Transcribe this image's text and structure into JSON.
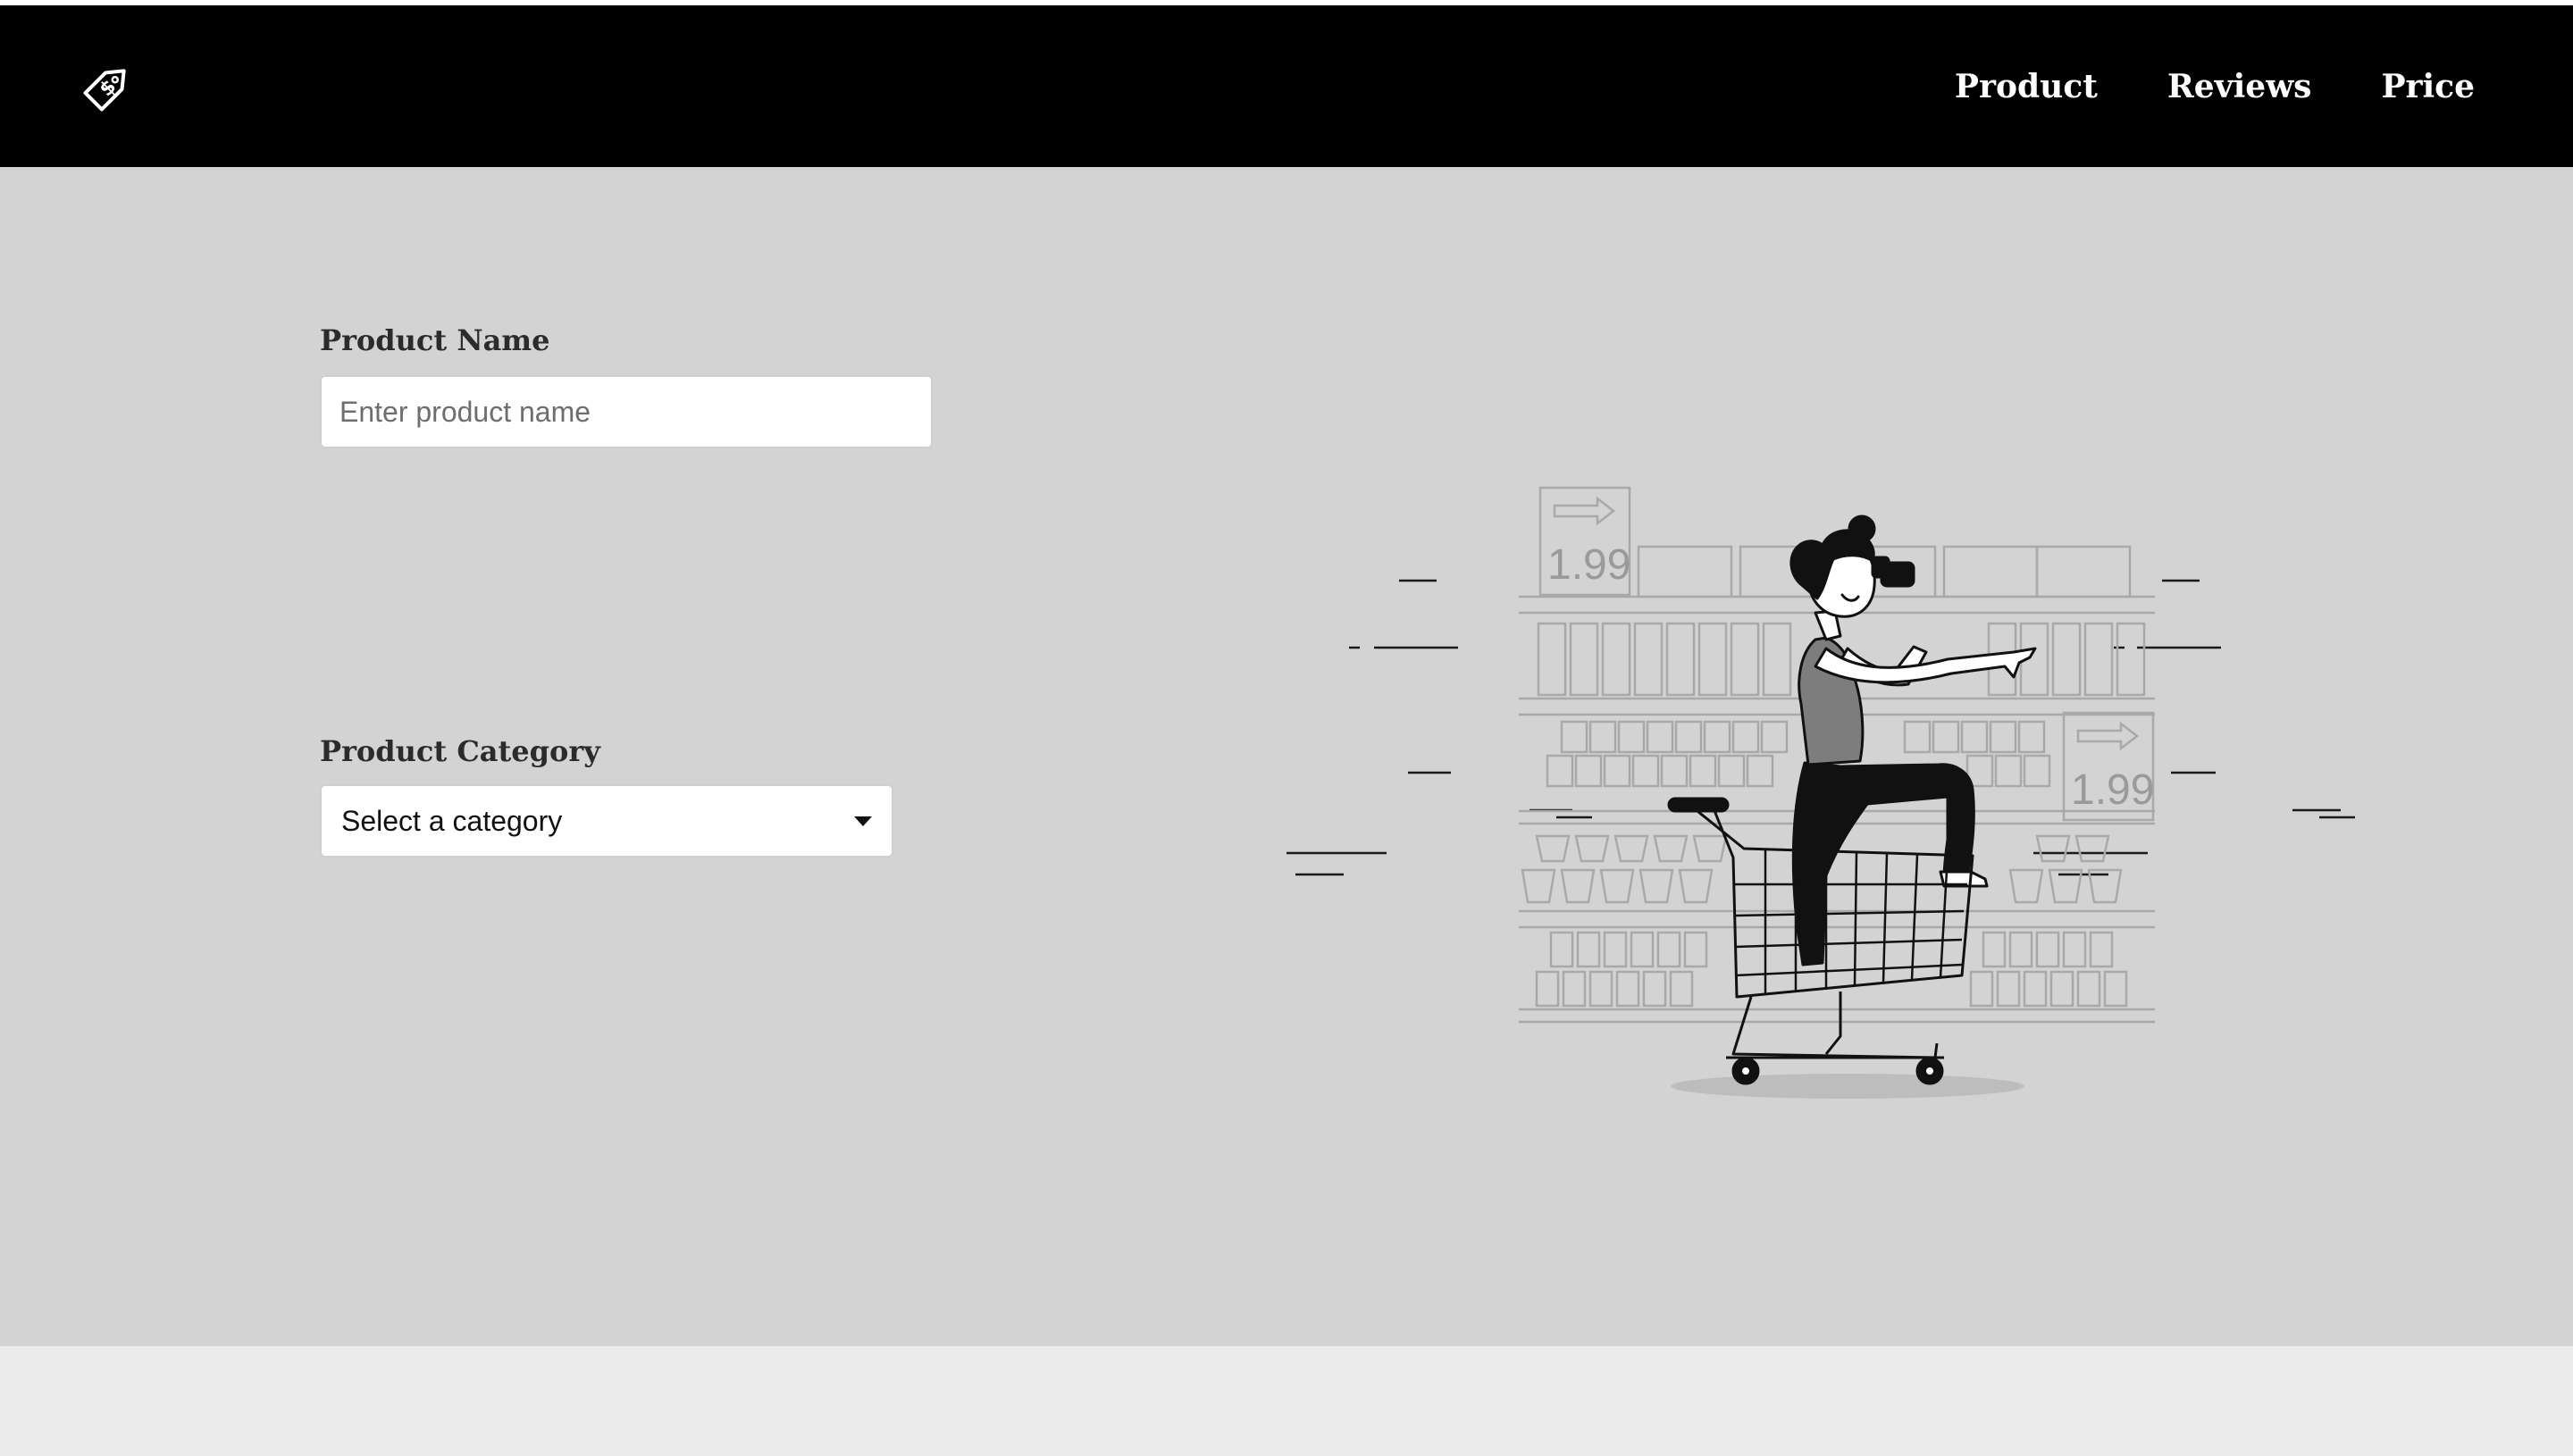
{
  "navbar": {
    "logo_icon": "price-tag-dollar-icon",
    "links": [
      {
        "label": "Product"
      },
      {
        "label": "Reviews"
      },
      {
        "label": "Price"
      }
    ]
  },
  "form": {
    "product_name": {
      "label": "Product Name",
      "value": "",
      "placeholder": "Enter product name"
    },
    "product_category": {
      "label": "Product Category",
      "selected": "Select a category"
    }
  },
  "illustration": {
    "price_tags": [
      "1.99",
      "1.99"
    ]
  },
  "colors": {
    "navbar": "#000000",
    "hero": "#d3d3d3",
    "footer": "#ececec"
  }
}
